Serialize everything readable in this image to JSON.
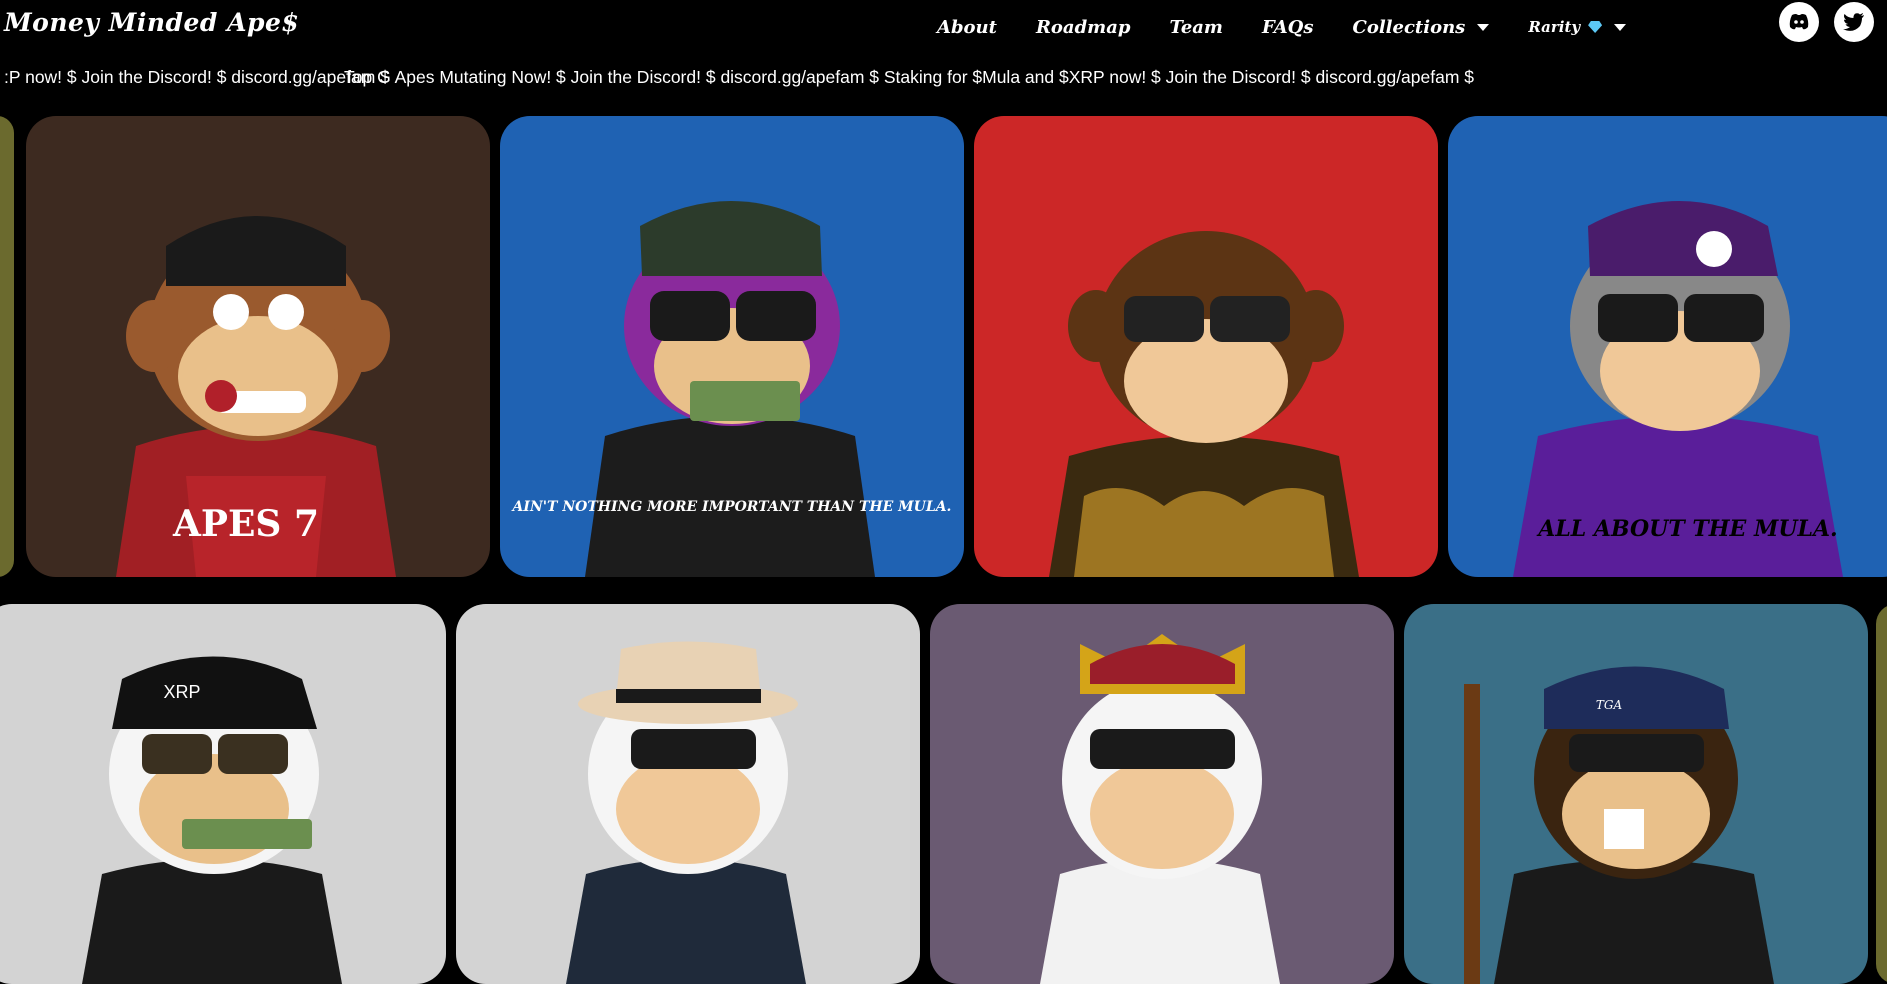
{
  "header": {
    "logo": "Money Minded Ape$",
    "nav": [
      {
        "label": "About"
      },
      {
        "label": "Roadmap"
      },
      {
        "label": "Team"
      },
      {
        "label": "FAQs"
      },
      {
        "label": "Collections"
      },
      {
        "label": "Rarity"
      }
    ],
    "social": [
      "discord-icon",
      "twitter-icon"
    ]
  },
  "ticker": {
    "segment_a": ":P now!  $  Join the Discord!  $  discord.gg/apefam  $",
    "segment_b": "Top G Apes Mutating Now!  $  Join the Discord!  $  discord.gg/apefam  $  Staking for $Mula and $XRP now!  $  Join the Discord!  $  discord.gg/apefam  $"
  },
  "cards": [
    {
      "bg": "#3d2a20",
      "text": "APES 7"
    },
    {
      "bg": "#1f62b3",
      "text": "AIN'T NOTHING MORE IMPORTANT THAN THE MULA."
    },
    {
      "bg": "#cc2727",
      "text": ""
    },
    {
      "bg": "#1f62b3",
      "text": "ALL ABOUT THE MULA."
    },
    {
      "bg": "#d3d3d3",
      "text": "XRP"
    },
    {
      "bg": "#d3d3d3",
      "text": ""
    },
    {
      "bg": "#6a5a72",
      "text": ""
    },
    {
      "bg": "#3a6f87",
      "text": "TGA"
    }
  ],
  "edge_colors": [
    "#6b6a2e",
    "#6b6a2e"
  ]
}
